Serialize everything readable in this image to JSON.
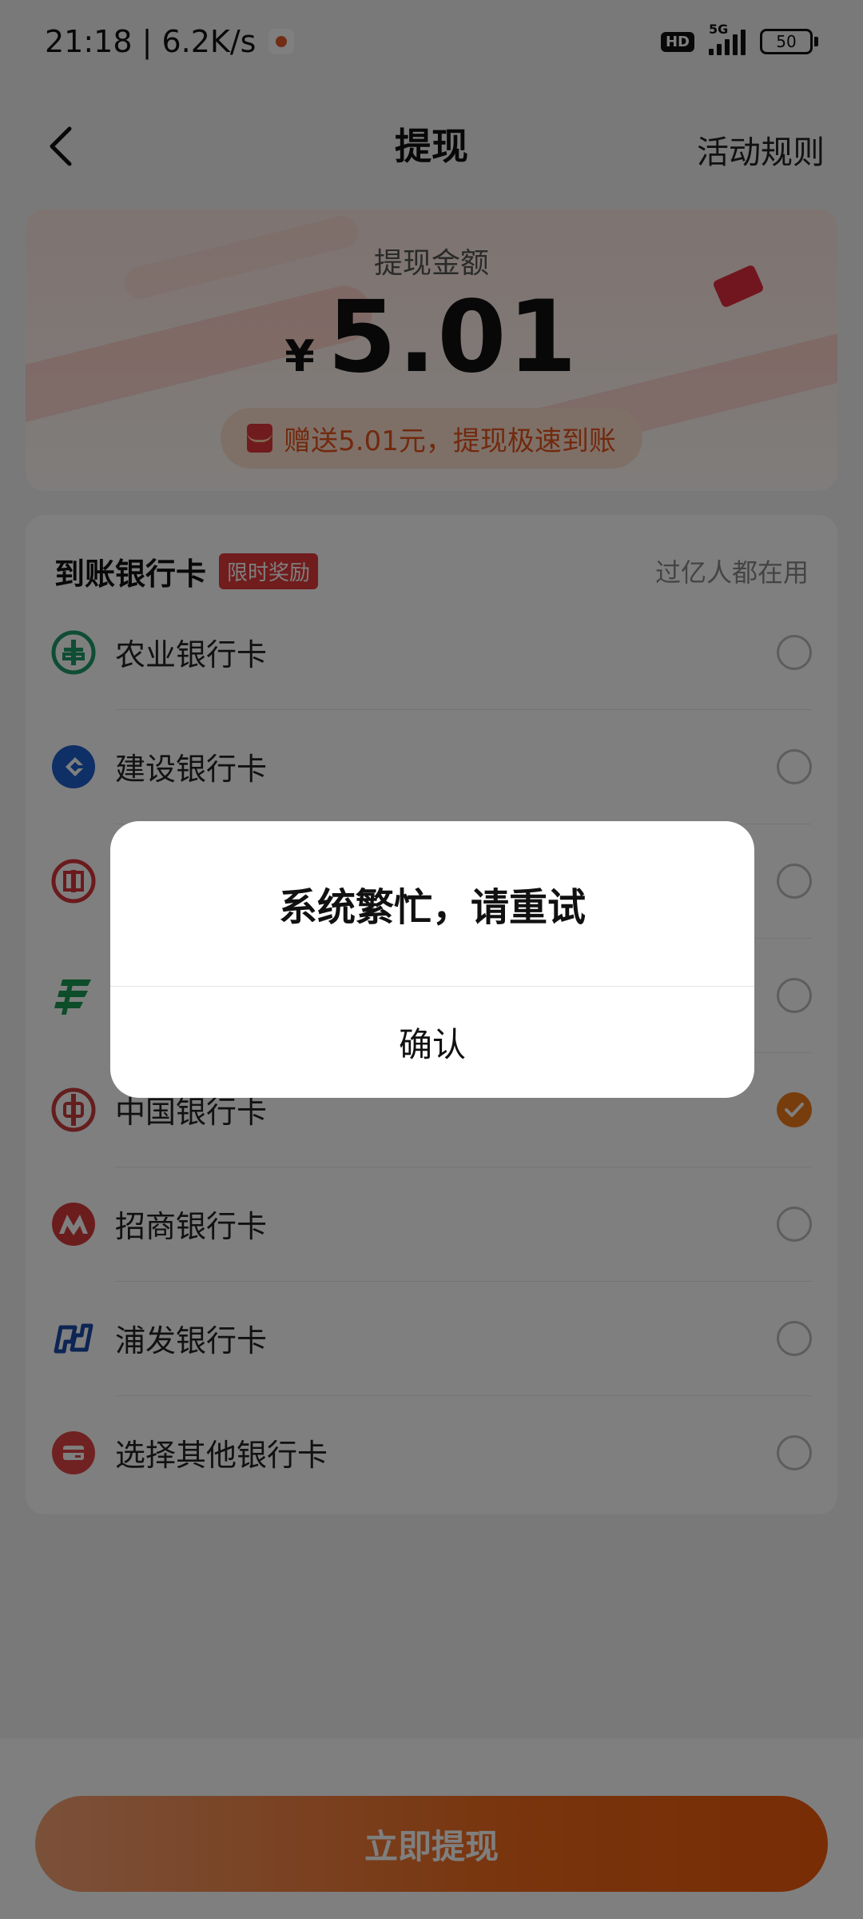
{
  "status_bar": {
    "time_speed": "21:18 | 6.2K/s",
    "hd": "HD",
    "network": "5G",
    "battery": "50"
  },
  "header": {
    "title": "提现",
    "rules": "活动规则"
  },
  "amount": {
    "label": "提现金额",
    "currency": "¥",
    "value": "5.01",
    "bonus": "赠送5.01元，提现极速到账"
  },
  "bank_section": {
    "title": "到账银行卡",
    "badge": "限时奖励",
    "note": "过亿人都在用",
    "banks": [
      {
        "name": "农业银行卡",
        "icon": "abc-bank-icon",
        "color": "#1f9a6a",
        "selected": false
      },
      {
        "name": "建设银行卡",
        "icon": "ccb-bank-icon",
        "color": "#1f5fcf",
        "selected": false
      },
      {
        "name": "",
        "icon": "icbc-bank-icon",
        "color": "#d6343a",
        "selected": false
      },
      {
        "name": "",
        "icon": "psbc-bank-icon",
        "color": "#1a9a55",
        "selected": false
      },
      {
        "name": "中国银行卡",
        "icon": "boc-bank-icon",
        "color": "#c93c3c",
        "selected": true
      },
      {
        "name": "招商银行卡",
        "icon": "cmb-bank-icon",
        "color": "#d63a3a",
        "selected": false
      },
      {
        "name": "浦发银行卡",
        "icon": "spdb-bank-icon",
        "color": "#1b4ba8",
        "selected": false
      },
      {
        "name": "选择其他银行卡",
        "icon": "other-card-icon",
        "color": "#e04545",
        "selected": false
      }
    ]
  },
  "withdraw_button": "立即提现",
  "dialog": {
    "message": "系统繁忙，请重试",
    "confirm": "确认"
  }
}
